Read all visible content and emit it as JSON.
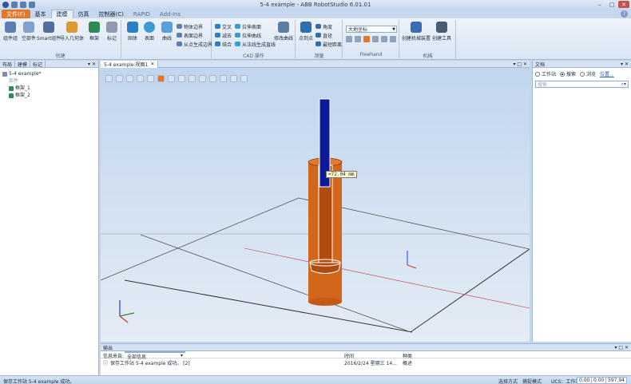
{
  "window": {
    "title": "5-4 example - ABB RobotStudio 6.01.01",
    "controls": {
      "minimize": "–",
      "maximize": "□",
      "close": "✕"
    }
  },
  "ribbon_tabs": [
    "文件(F)",
    "基本",
    "建模",
    "仿真",
    "控制器(C)",
    "RAPID",
    "Add-Ins"
  ],
  "ribbon": {
    "create": {
      "label": "创建",
      "buttons": [
        "组件组",
        "空部件",
        "Smart组件",
        "导入几何体",
        "框架",
        "标记"
      ]
    },
    "modeling": {
      "buttons": [
        "固体",
        "表面",
        "曲线"
      ],
      "border_buttons": [
        "物体边界",
        "表面边界",
        "从点生成边界"
      ]
    },
    "cad": {
      "label": "CAD 操作",
      "buttons": [
        "交叉",
        "减去",
        "结合",
        "拉伸表面",
        "拉伸曲线",
        "从法线生成直线"
      ],
      "modify_curve": "修改曲线"
    },
    "measure": {
      "label": "测量",
      "point_to_point": "点到点",
      "buttons": [
        "角度",
        "直径",
        "最短距离"
      ]
    },
    "freehand": {
      "label": "Freehand",
      "combo": "大地坐标"
    },
    "mechanism": {
      "label": "机械",
      "buttons": [
        "创建机械装置",
        "创建工具"
      ]
    }
  },
  "left_panel": {
    "tabs": [
      "布局",
      "建模",
      "标记"
    ],
    "tree": {
      "root": "5-4 example*",
      "group": "部件",
      "items": [
        "框架_1",
        "框架_2"
      ]
    }
  },
  "viewport": {
    "tab_title": "5-4 example:视图1",
    "measurement": "=72.04 mm"
  },
  "right_panel": {
    "title": "文档",
    "options": [
      "工作站",
      "搜索",
      "浏览"
    ],
    "selected_option": "搜索",
    "location_link": "位置...",
    "search_placeholder": "搜索"
  },
  "output": {
    "title": "输出",
    "columns": {
      "source": "信息来自:",
      "time": "时间",
      "category": "种类"
    },
    "filter": "全部信息",
    "rows": [
      {
        "message": "保存工作站 5-4 example 成功。 [2]",
        "time": "2016/2/24 星期三 14...",
        "category": "概述"
      }
    ]
  },
  "status_bar": {
    "message": "保存工作站 5-4 example 成功。",
    "selection_mode": "选择方式",
    "capture_mode": "捕捉模式",
    "ucs": "UCS：工作站",
    "coords": [
      "0.00",
      "0.00",
      "597.94"
    ]
  },
  "colors": {
    "accent": "#e0772a",
    "cylinder": "#d2661a",
    "pole": "#0b1a9a",
    "floor_top": "#bfcfe3",
    "floor_bottom": "#e4ecf5"
  }
}
